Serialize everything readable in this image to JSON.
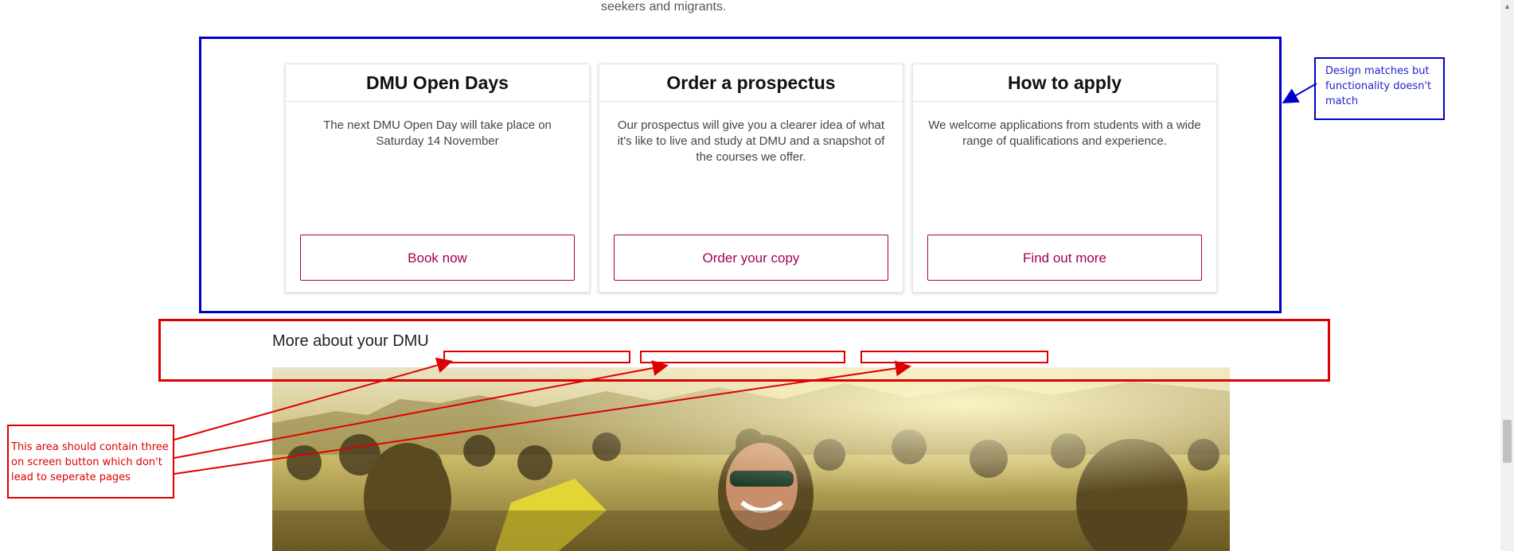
{
  "intro": {
    "tail_text": "seekers and migrants."
  },
  "cards": [
    {
      "title": "DMU Open Days",
      "text": "The next DMU Open Day will take place on Saturday 14 November",
      "button_label": "Book now"
    },
    {
      "title": "Order a prospectus",
      "text": "Our prospectus will give you a clearer idea of what it's like to live and study at DMU and a snapshot of the courses we offer.",
      "button_label": "Order your copy"
    },
    {
      "title": "How to apply",
      "text": "We welcome applications from students with a wide range of qualifications and experience.",
      "button_label": "Find out more"
    }
  ],
  "section": {
    "heading": "More about your DMU"
  },
  "annotations": {
    "blue_note": "Design matches but functionality doesn't match",
    "red_note": "This area should contain three on screen button which don't lead to seperate pages",
    "blue_color": "#0000cc",
    "red_color": "#dd0000"
  },
  "colors": {
    "brand": "#a2004f",
    "card_border": "#e3e3e3"
  },
  "icons": {
    "scroll_up": "scroll-up-arrow-icon"
  }
}
